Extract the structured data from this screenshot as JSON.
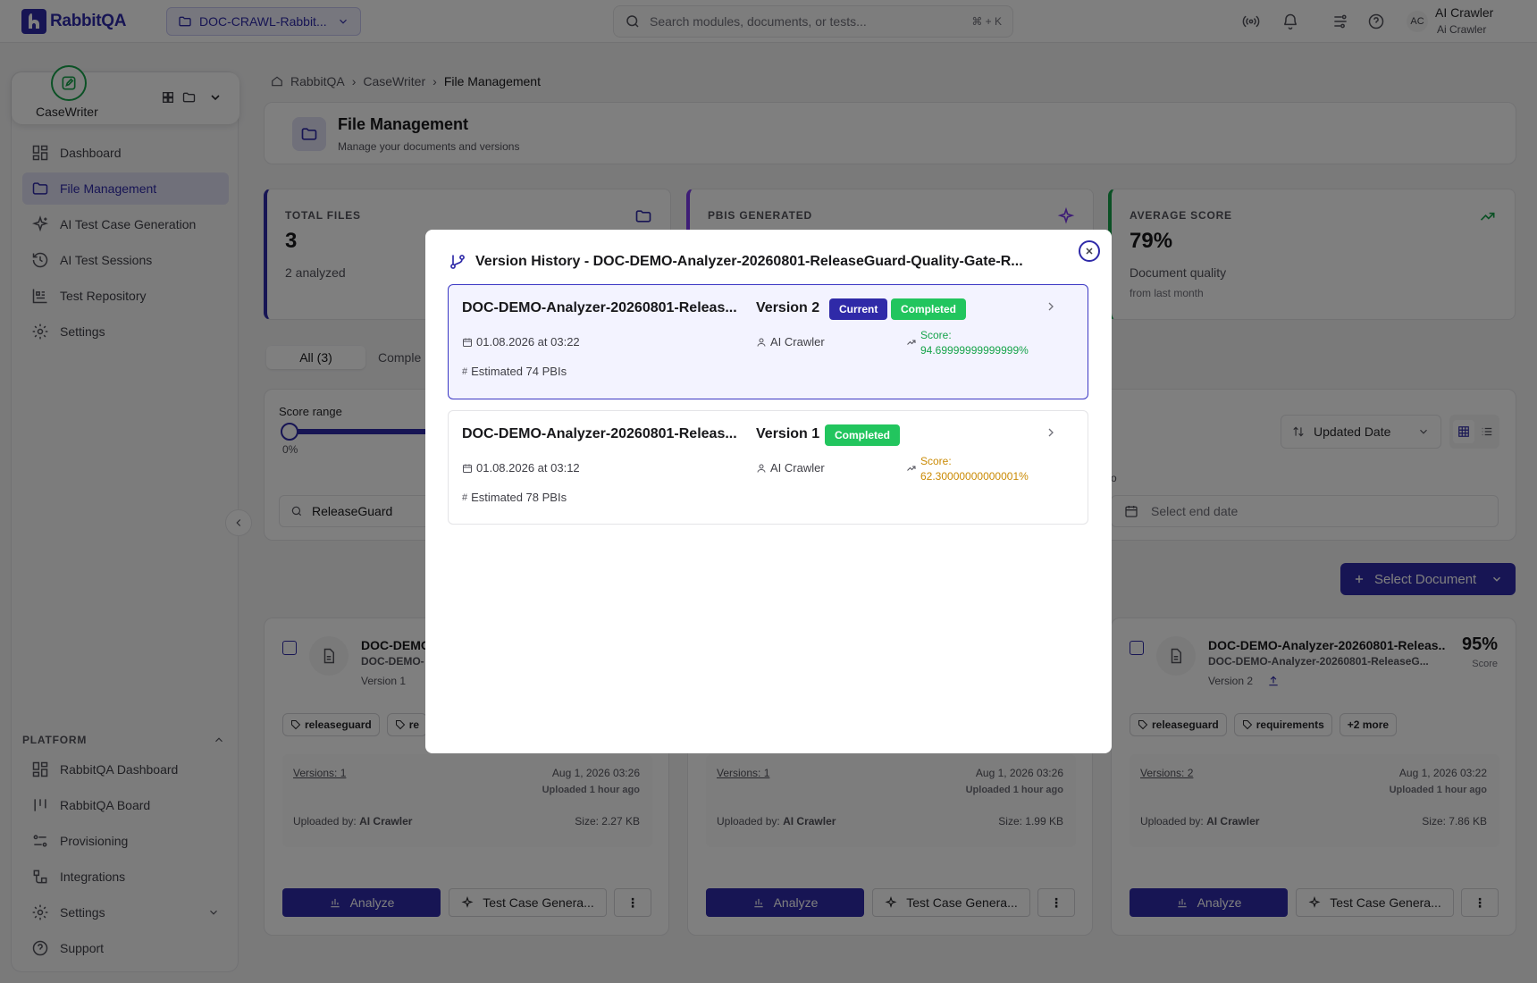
{
  "topbar": {
    "logo": "RabbitQA",
    "project": "DOC-CRAWL-Rabbit...",
    "search_placeholder": "Search modules, documents, or tests...",
    "search_shortcut": "⌘ + K",
    "avatar_initials": "AC",
    "user_name": "AI Crawler",
    "user_role": "Ai Crawler"
  },
  "sidebar": {
    "app_name": "CaseWriter",
    "items": [
      {
        "label": "Dashboard",
        "icon": "dashboard-icon"
      },
      {
        "label": "File Management",
        "icon": "folder-icon",
        "active": true
      },
      {
        "label": "AI Test Case Generation",
        "icon": "sparkles-icon"
      },
      {
        "label": "AI Test Sessions",
        "icon": "history-icon"
      },
      {
        "label": "Test Repository",
        "icon": "repository-icon"
      },
      {
        "label": "Settings",
        "icon": "gear-icon"
      }
    ],
    "platform_title": "PLATFORM",
    "platform_items": [
      {
        "label": "RabbitQA Dashboard",
        "icon": "dashboard-icon"
      },
      {
        "label": "RabbitQA Board",
        "icon": "board-icon"
      },
      {
        "label": "Provisioning",
        "icon": "provisioning-icon"
      },
      {
        "label": "Integrations",
        "icon": "integrations-icon"
      },
      {
        "label": "Settings",
        "icon": "gear-icon"
      },
      {
        "label": "Support",
        "icon": "help-icon"
      }
    ]
  },
  "breadcrumb": {
    "home": "RabbitQA",
    "section": "CaseWriter",
    "current": "File Management"
  },
  "page": {
    "title": "File Management",
    "subtitle": "Manage your documents and versions"
  },
  "stats": [
    {
      "label": "TOTAL FILES",
      "value": "3",
      "sub": "2 analyzed",
      "color": "#2f2aa8"
    },
    {
      "label": "PBIS GENERATED",
      "value": "",
      "sub": "",
      "color": "#7c3aed"
    },
    {
      "label": "AVERAGE SCORE",
      "value": "79%",
      "sub": "Document quality",
      "sub2": "from last month",
      "color": "#16a34a"
    }
  ],
  "tabs": {
    "all": "All (3)",
    "completed": "Comple"
  },
  "filters": {
    "score_label": "Score range",
    "score_min": "0%",
    "search_value": "ReleaseGuard",
    "sort_value": "Updated Date",
    "end_date_placeholder": "Select end date",
    "to_label": "o"
  },
  "select_document": "Select Document",
  "cards": [
    {
      "title": "DOC-DEMO",
      "sub": "DOC-DEMO-",
      "version": "Version 1",
      "tags": [
        "releaseguard",
        "re"
      ],
      "versions": "Versions: 1",
      "date": "Aug 1, 2026 03:26",
      "ago": "Uploaded 1 hour ago",
      "uploaded_label": "Uploaded by:",
      "uploader": "AI Crawler",
      "size": "Size: 2.27 KB",
      "analyze": "Analyze",
      "testgen": "Test Case Genera..."
    },
    {
      "title": "",
      "sub": "",
      "version": "",
      "tags": [],
      "versions": "Versions: 1",
      "date": "Aug 1, 2026 03:26",
      "ago": "Uploaded 1 hour ago",
      "uploaded_label": "Uploaded by:",
      "uploader": "AI Crawler",
      "size": "Size: 1.99 KB",
      "analyze": "Analyze",
      "testgen": "Test Case Genera..."
    },
    {
      "title": "DOC-DEMO-Analyzer-20260801-Releas...",
      "sub": "DOC-DEMO-Analyzer-20260801-ReleaseG...",
      "version": "Version 2",
      "score": "95%",
      "score_label": "Score",
      "tags": [
        "releaseguard",
        "requirements",
        "+2 more"
      ],
      "versions": "Versions: 2",
      "date": "Aug 1, 2026 03:22",
      "ago": "Uploaded 1 hour ago",
      "uploaded_label": "Uploaded by:",
      "uploader": "AI Crawler",
      "size": "Size: 7.86 KB",
      "analyze": "Analyze",
      "testgen": "Test Case Genera..."
    }
  ],
  "modal": {
    "title": "Version History - DOC-DEMO-Analyzer-20260801-ReleaseGuard-Quality-Gate-R...",
    "versions": [
      {
        "name": "DOC-DEMO-Analyzer-20260801-Releas...",
        "version": "Version 2",
        "current_badge": "Current",
        "status": "Completed",
        "date": "01.08.2026 at 03:22",
        "author": "AI Crawler",
        "score_label": "Score:",
        "score": "94.69999999999999%",
        "pbis": "Estimated 74 PBIs",
        "score_color": "#16a34a"
      },
      {
        "name": "DOC-DEMO-Analyzer-20260801-Releas...",
        "version": "Version 1",
        "status": "Completed",
        "date": "01.08.2026 at 03:12",
        "author": "AI Crawler",
        "score_label": "Score:",
        "score": "62.30000000000001%",
        "pbis": "Estimated 78 PBIs",
        "score_color": "#ca8a04"
      }
    ]
  }
}
